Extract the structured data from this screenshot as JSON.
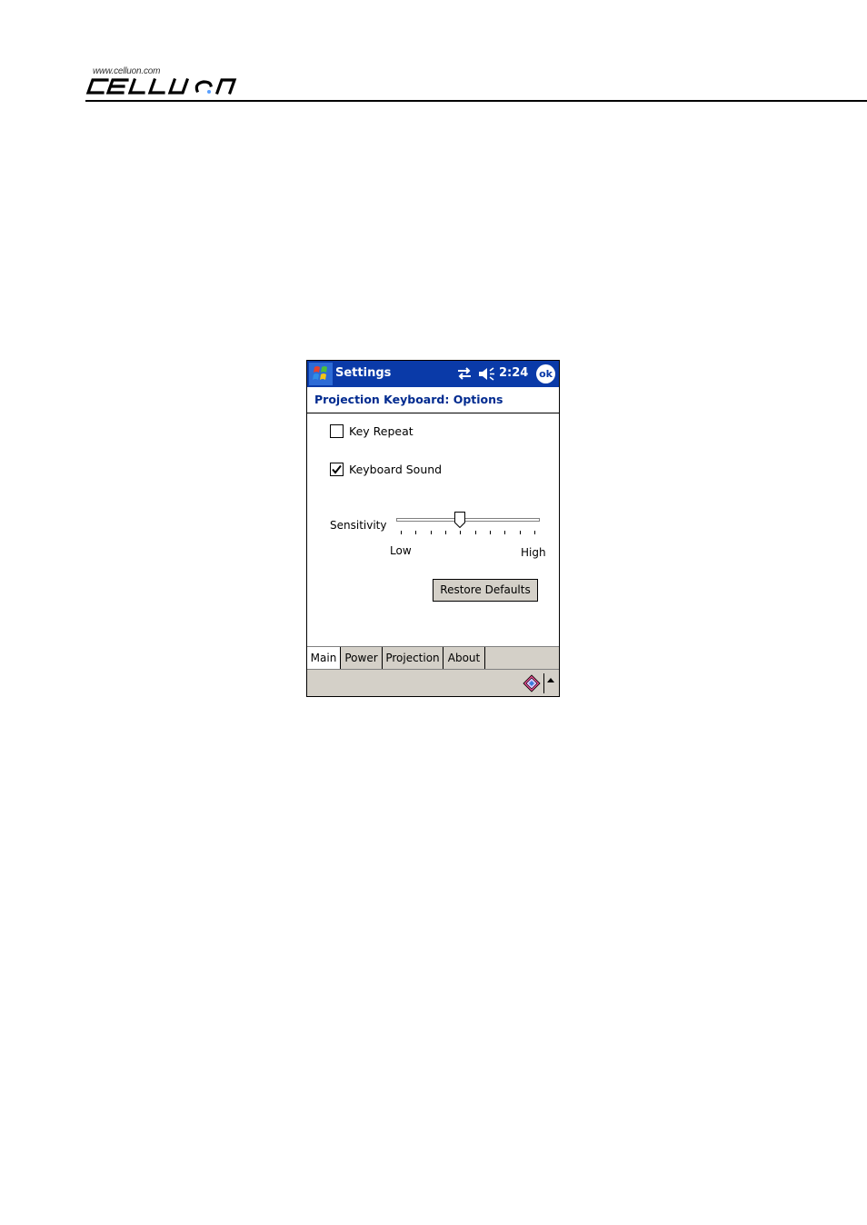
{
  "header": {
    "logo_url": "www.celluon.com",
    "logo_text": "CELLUON"
  },
  "device": {
    "titlebar": {
      "title": "Settings",
      "time": "2:24",
      "ok_label": "ok",
      "color": "#0a3aa8"
    },
    "page_heading": "Projection Keyboard: Options",
    "options": {
      "key_repeat": {
        "label": "Key Repeat",
        "checked": false
      },
      "keyboard_sound": {
        "label": "Keyboard Sound",
        "checked": true
      }
    },
    "sensitivity": {
      "label": "Sensitivity",
      "low_label": "Low",
      "high_label": "High",
      "tick_count": 10,
      "level_fraction": 0.44
    },
    "restore_button": "Restore Defaults",
    "tabs": [
      {
        "label": "Main",
        "active": true
      },
      {
        "label": "Power",
        "active": false
      },
      {
        "label": "Projection",
        "active": false
      },
      {
        "label": "About",
        "active": false
      }
    ],
    "menubar": {
      "input_icon": "keyboard-input-icon",
      "arrow_icon": "up-arrow-icon"
    }
  }
}
